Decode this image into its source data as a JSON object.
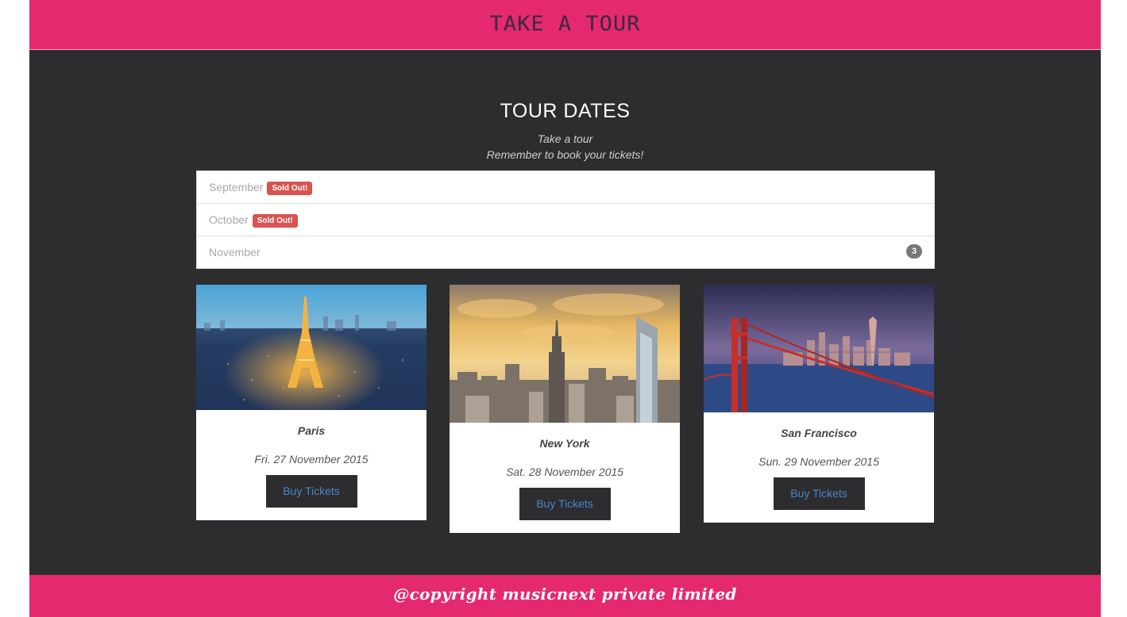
{
  "header": {
    "title": "TAKE A TOUR"
  },
  "tour": {
    "heading": "TOUR DATES",
    "subtitle_1": "Take a tour",
    "subtitle_2": "Remember to book your tickets!",
    "months": [
      {
        "label": "September",
        "badge": "Sold Out!"
      },
      {
        "label": "October",
        "badge": "Sold Out!"
      },
      {
        "label": "November",
        "count": "3"
      }
    ],
    "cards": [
      {
        "city": "Paris",
        "date": "Fri. 27 November 2015",
        "button": "Buy Tickets",
        "image": "paris-eiffel-tower-night"
      },
      {
        "city": "New York",
        "date": "Sat. 28 November 2015",
        "button": "Buy Tickets",
        "image": "new-york-skyline-sunset"
      },
      {
        "city": "San Francisco",
        "date": "Sun. 29 November 2015",
        "button": "Buy Tickets",
        "image": "golden-gate-bridge"
      }
    ]
  },
  "footer": {
    "text": "@copyright musicnext private limited"
  },
  "colors": {
    "brand_pink": "#e5296f",
    "dark_bg": "#2d2d30",
    "sold_out_red": "#d9534f",
    "badge_gray": "#777777",
    "link_blue": "#4a86c6"
  }
}
